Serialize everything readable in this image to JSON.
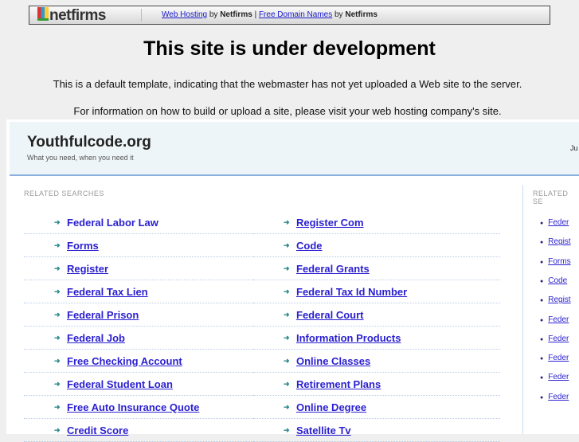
{
  "topbar": {
    "logo": "netfirms",
    "link1": "Web Hosting",
    "by1": "by",
    "brand1": "Netfirms",
    "pipe": "|",
    "link2": "Free Domain Names",
    "by2": "by",
    "brand2": "Netfirms"
  },
  "title": "This site is under development",
  "line1": "This is a default template, indicating that the webmaster has not yet uploaded a Web site to the server.",
  "line2": "For information on how to build or upload a site, please visit your web hosting company's site.",
  "site": {
    "name": "Youthfulcode.org",
    "tagline": "What you need, when you need it",
    "right_text": "Ju"
  },
  "related_label": "RELATED SEARCHES",
  "related_label_right": "RELATED SE",
  "left_col": [
    "Federal Labor Law",
    "Forms",
    "Register",
    "Federal Tax Lien",
    "Federal Prison",
    "Federal Job",
    "Free Checking Account",
    "Federal Student Loan",
    "Free Auto Insurance Quote",
    "Credit Score"
  ],
  "right_col": [
    "Register Com",
    "Code",
    "Federal Grants",
    "Federal Tax Id Number",
    "Federal Court",
    "Information Products",
    "Online Classes",
    "Retirement Plans",
    "Online Degree",
    "Satellite Tv"
  ],
  "side_col": [
    "Feder",
    "Regist",
    "Forms",
    "Code",
    "Regist",
    "Feder",
    "Feder",
    "Feder",
    "Feder",
    "Feder"
  ]
}
